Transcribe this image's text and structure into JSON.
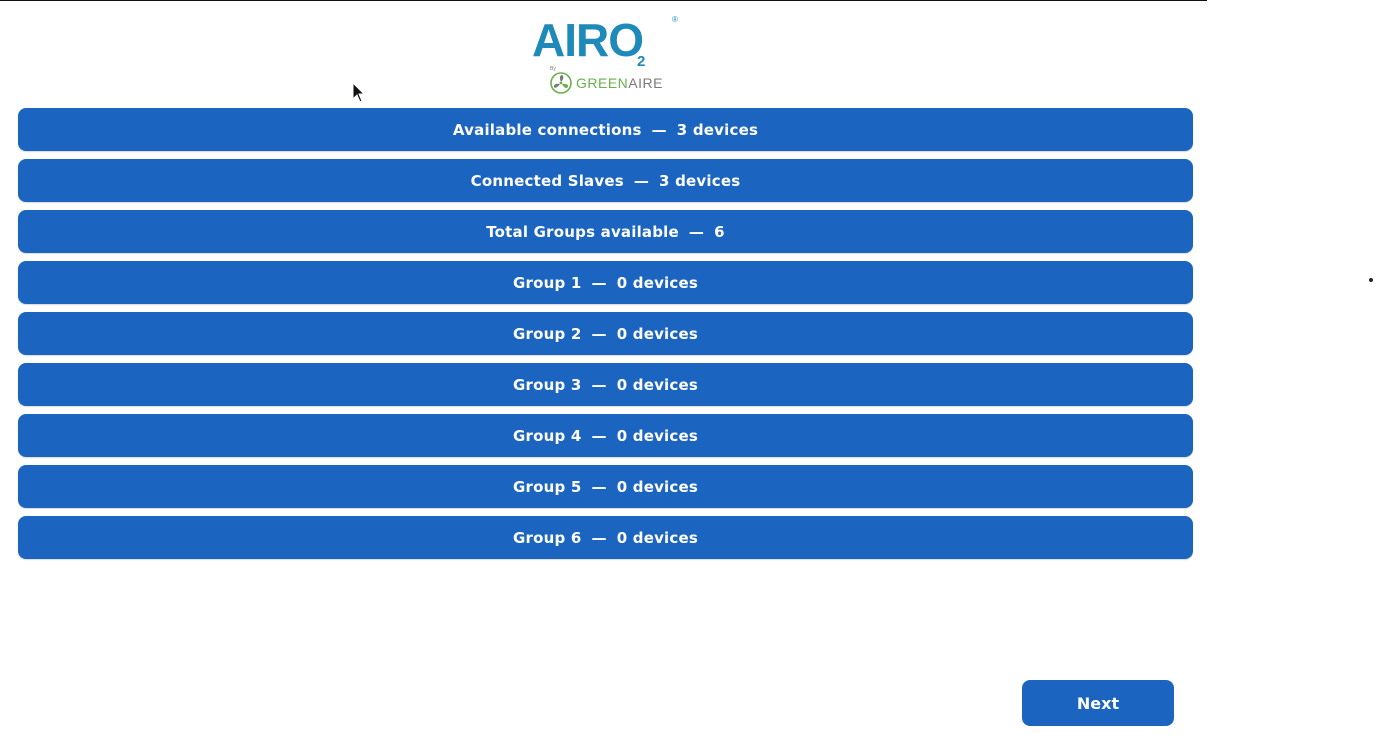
{
  "logo": {
    "brand_word": "AIRO",
    "subscript": "2",
    "registered": "®",
    "by": "By",
    "company_green": "GREEN",
    "company_gray": "AIRE"
  },
  "separator": "—",
  "rows": [
    {
      "label": "Available connections",
      "value": "3 devices"
    },
    {
      "label": "Connected Slaves",
      "value": "3 devices"
    },
    {
      "label": "Total Groups available",
      "value": "6"
    },
    {
      "label": "Group 1",
      "value": "0 devices"
    },
    {
      "label": "Group 2",
      "value": "0 devices"
    },
    {
      "label": "Group 3",
      "value": "0 devices"
    },
    {
      "label": "Group 4",
      "value": "0 devices"
    },
    {
      "label": "Group 5",
      "value": "0 devices"
    },
    {
      "label": "Group 6",
      "value": "0 devices"
    }
  ],
  "next_button": {
    "label": "Next"
  },
  "colors": {
    "primary": "#1b65c0",
    "logo_teal": "#1e8ab9",
    "logo_green": "#6ab04c",
    "logo_gray": "#7b7b7b"
  }
}
